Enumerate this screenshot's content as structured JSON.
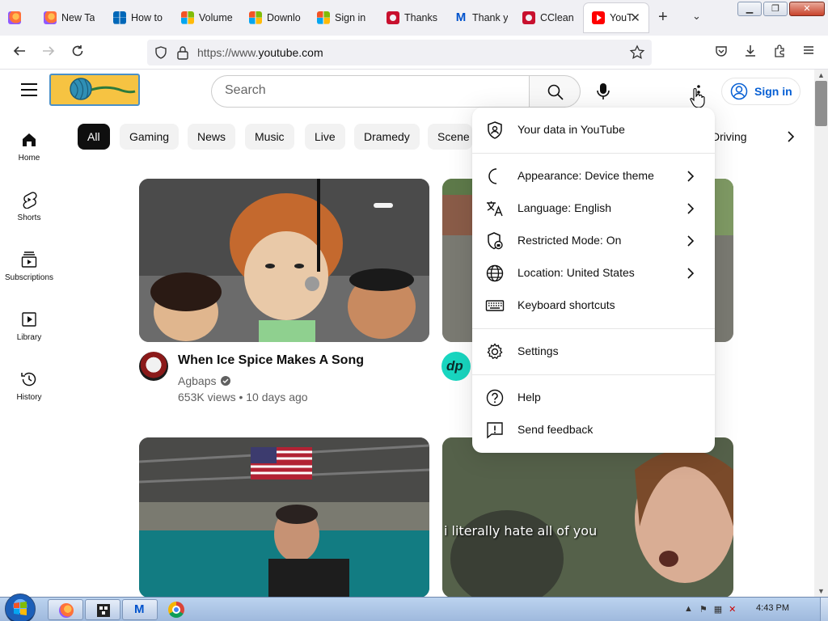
{
  "browser": {
    "tabs": [
      {
        "label": "",
        "icon": "firefox-icon"
      },
      {
        "label": "New Ta",
        "icon": "firefox-icon"
      },
      {
        "label": "How to",
        "icon": "windows-icon"
      },
      {
        "label": "Volume",
        "icon": "windows-icon"
      },
      {
        "label": "Downlo",
        "icon": "windows-icon"
      },
      {
        "label": "Sign in",
        "icon": "windows-icon"
      },
      {
        "label": "Thanks",
        "icon": "ccleaner-icon"
      },
      {
        "label": "Thank y",
        "icon": "malwarebytes-icon"
      },
      {
        "label": "CClean",
        "icon": "ccleaner-icon"
      },
      {
        "label": "YouT",
        "icon": "youtube-icon"
      }
    ],
    "url_prefix": "https://www.",
    "url_domain": "youtube.com"
  },
  "youtube": {
    "search_placeholder": "Search",
    "sign_in": "Sign in",
    "chips": [
      "All",
      "Gaming",
      "News",
      "Music",
      "Live",
      "Dramedy",
      "Scene"
    ],
    "chip_driving": "Driving",
    "nav": [
      {
        "label": "Home",
        "icon": "home-icon"
      },
      {
        "label": "Shorts",
        "icon": "shorts-icon"
      },
      {
        "label": "Subscriptions",
        "icon": "subscriptions-icon"
      },
      {
        "label": "Library",
        "icon": "library-icon"
      },
      {
        "label": "History",
        "icon": "history-icon"
      }
    ],
    "videos": [
      {
        "title": "When Ice Spice Makes A Song",
        "channel": "Agbaps",
        "meta": "653K views • 10 days ago",
        "verified": true
      },
      {
        "caption": "i literally hate all of you"
      }
    ],
    "avatar2_text": "dp"
  },
  "menu": {
    "items": [
      {
        "label": "Your data in YouTube",
        "icon": "data-shield-icon"
      },
      {
        "label": "Appearance: Device theme",
        "icon": "moon-icon"
      },
      {
        "label": "Language: English",
        "icon": "translate-icon"
      },
      {
        "label": "Restricted Mode: On",
        "icon": "restricted-icon"
      },
      {
        "label": "Location: United States",
        "icon": "globe-icon"
      },
      {
        "label": "Keyboard shortcuts",
        "icon": "keyboard-icon"
      },
      {
        "label": "Settings",
        "icon": "gear-icon"
      },
      {
        "label": "Help",
        "icon": "help-icon"
      },
      {
        "label": "Send feedback",
        "icon": "feedback-icon"
      }
    ]
  },
  "taskbar": {
    "clock": "4:43 PM"
  }
}
